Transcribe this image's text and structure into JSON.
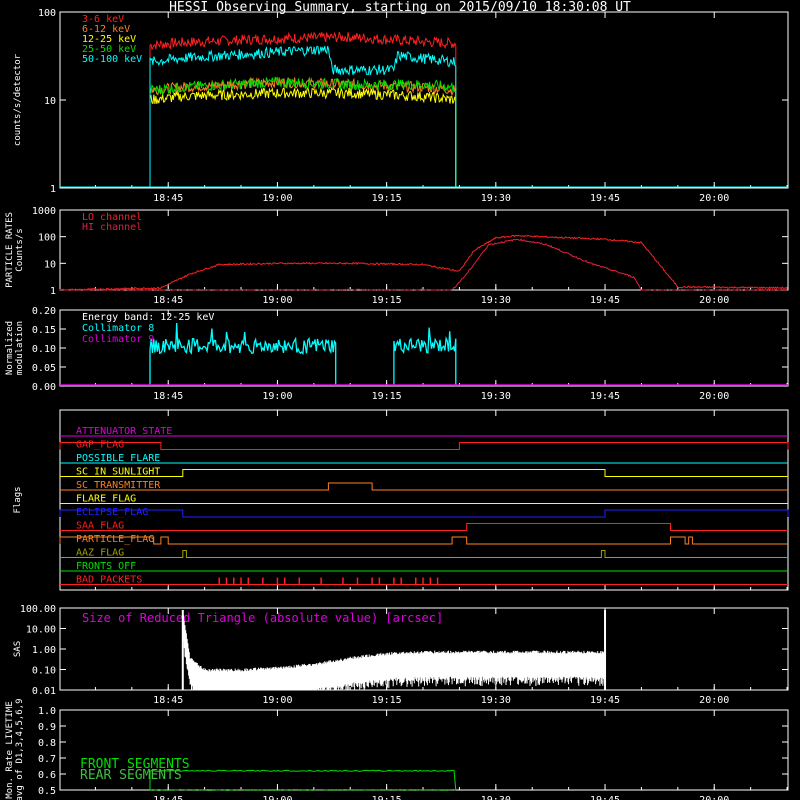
{
  "title": "HESSI Observing Summary, starting on 2015/09/10 18:30:08 UT",
  "time_ticks": [
    "18:45",
    "19:00",
    "19:15",
    "19:30",
    "19:45",
    "20:00"
  ],
  "colors": {
    "bg": "#000000",
    "axis": "#ffffff",
    "red": "#ff2020",
    "orange": "#ff7f1e",
    "yellow": "#ffff00",
    "green": "#00e000",
    "cyan": "#00ffff",
    "magenta": "#e000e0",
    "blue": "#2020ff",
    "olive": "#a0a000",
    "crimson": "#e02040",
    "flare_green": "#40c040"
  },
  "chart_data": [
    {
      "type": "line",
      "id": "count-rates",
      "ylabel": "counts/s/detector",
      "ylim": [
        1,
        100
      ],
      "log": true,
      "yticks": [
        "1",
        "10",
        "100"
      ],
      "xlim": [
        "18:30:08",
        "20:10:08"
      ],
      "series": [
        {
          "name": "3-6 keV",
          "color_key": "red",
          "x": [
            "18:42:30",
            "18:47",
            "19:00",
            "19:10",
            "19:20",
            "19:24:30"
          ],
          "values": [
            42,
            45,
            50,
            52,
            46,
            44
          ]
        },
        {
          "name": "6-12 keV",
          "color_key": "orange",
          "x": [
            "18:42:30",
            "18:47",
            "19:00",
            "19:10",
            "19:20",
            "19:24:30"
          ],
          "values": [
            13,
            14,
            16,
            15,
            14,
            13
          ]
        },
        {
          "name": "12-25 keV",
          "color_key": "yellow",
          "x": [
            "18:42:30",
            "18:47",
            "19:00",
            "19:10",
            "19:20",
            "19:24:30"
          ],
          "values": [
            10,
            11,
            12,
            12,
            11,
            10
          ]
        },
        {
          "name": "25-50 keV",
          "color_key": "green",
          "x": [
            "18:42:30",
            "18:47",
            "19:00",
            "19:10",
            "19:20",
            "19:24:30"
          ],
          "values": [
            13,
            14,
            16,
            15,
            15,
            14
          ]
        },
        {
          "name": "50-100 keV",
          "color_key": "cyan",
          "x": [
            "18:42:30",
            "18:47",
            "19:00",
            "19:07",
            "19:07:30",
            "19:16",
            "19:16:30",
            "19:24:30"
          ],
          "values": [
            27,
            30,
            35,
            38,
            22,
            22,
            32,
            27
          ]
        }
      ]
    },
    {
      "type": "line",
      "id": "particle-rates",
      "ylabel_lines": [
        "PARTICLE RATES",
        "Counts/s"
      ],
      "ylim": [
        1,
        1000
      ],
      "log": true,
      "yticks": [
        "1",
        "10",
        "100",
        "1000"
      ],
      "series": [
        {
          "name": "LO channel",
          "color_key": "red",
          "x": [
            "18:30:08",
            "18:44",
            "18:48",
            "18:52",
            "19:00",
            "19:10",
            "19:20",
            "19:25",
            "19:27",
            "19:30",
            "19:33",
            "19:36",
            "19:45",
            "19:50",
            "19:53",
            "19:55",
            "20:10"
          ],
          "values": [
            1,
            1.2,
            4,
            9,
            10,
            10,
            9,
            5,
            30,
            90,
            110,
            100,
            80,
            60,
            6,
            1.3,
            1.2
          ]
        },
        {
          "name": "HI channel",
          "color_key": "crimson",
          "x": [
            "18:30:08",
            "19:24",
            "19:26",
            "19:29",
            "19:33",
            "19:37",
            "19:43",
            "19:49",
            "19:50",
            "20:10"
          ],
          "values": [
            1,
            1,
            4,
            50,
            80,
            50,
            10,
            3,
            1,
            1
          ]
        }
      ]
    },
    {
      "type": "line",
      "id": "modulation",
      "ylabel_lines": [
        "Normalized",
        "modulation"
      ],
      "ylim": [
        0,
        0.2
      ],
      "yticks": [
        "0.00",
        "0.05",
        "0.10",
        "0.15",
        "0.20"
      ],
      "annotation": "Energy band: 12-25 keV",
      "series": [
        {
          "name": "Collimator 8",
          "color_key": "cyan",
          "segments": [
            [
              "18:42:30",
              "19:08"
            ],
            [
              "19:16",
              "19:24:30"
            ]
          ],
          "value": 0.105
        },
        {
          "name": "Collimator 9",
          "color_key": "magenta",
          "value": 0.0
        }
      ]
    },
    {
      "type": "table",
      "id": "flags",
      "ylabel": "Flags",
      "rows": [
        {
          "label": "ATTENUATOR_STATE",
          "color_key": "magenta",
          "on": []
        },
        {
          "label": "GAP_FLAG",
          "color_key": "red",
          "on": [
            [
              "18:30:08",
              "18:44"
            ],
            [
              "19:25",
              "20:10:08"
            ]
          ]
        },
        {
          "label": "POSSIBLE_FLARE",
          "color_key": "cyan",
          "on": []
        },
        {
          "label": "SC_IN_SUNLIGHT",
          "color_key": "yellow",
          "on": [
            [
              "18:47",
              "19:45"
            ]
          ]
        },
        {
          "label": "SC_TRANSMITTER",
          "color_key": "orange",
          "on": [
            [
              "19:07",
              "19:13"
            ]
          ]
        },
        {
          "label": "FLARE_FLAG",
          "color_key": "yellow",
          "on": []
        },
        {
          "label": "ECLIPSE_FLAG",
          "color_key": "blue",
          "on": [
            [
              "18:30:08",
              "18:47"
            ],
            [
              "19:45",
              "20:10:08"
            ]
          ]
        },
        {
          "label": "SAA_FLAG",
          "color_key": "red",
          "on": [
            [
              "19:26",
              "19:54"
            ]
          ]
        },
        {
          "label": "PARTICLE_FLAG",
          "color_key": "orange",
          "on": [
            [
              "18:30:08",
              "18:43"
            ],
            [
              "18:44",
              "18:45"
            ],
            [
              "19:24",
              "19:26"
            ],
            [
              "19:54",
              "19:56"
            ],
            [
              "19:56:30",
              "19:57"
            ]
          ]
        },
        {
          "label": "AAZ_FLAG",
          "color_key": "olive",
          "on": [
            [
              "18:47",
              "18:47:30"
            ],
            [
              "19:44:30",
              "19:45"
            ]
          ]
        },
        {
          "label": "FRONTS_OFF",
          "color_key": "green",
          "on": []
        },
        {
          "label": "BAD_PACKETS",
          "color_key": "red",
          "ticks": [
            "18:52",
            "18:53",
            "18:54",
            "18:55",
            "18:56",
            "18:58",
            "19:00",
            "19:01",
            "19:03",
            "19:06",
            "19:09",
            "19:11",
            "19:13",
            "19:14",
            "19:16",
            "19:17",
            "19:19",
            "19:20",
            "19:21",
            "19:22"
          ]
        }
      ]
    },
    {
      "type": "line",
      "id": "sas",
      "ylabel": "SAS",
      "ylim": [
        0.01,
        100
      ],
      "log": true,
      "yticks": [
        "0.01",
        "0.10",
        "1.00",
        "10.00",
        "100.00"
      ],
      "annotation": "Size of Reduced Triangle (absolute value) [arcsec]",
      "series": [
        {
          "name": "triangle",
          "color_key": "axis",
          "x": [
            "18:47",
            "18:48",
            "18:50",
            "18:55",
            "19:00",
            "19:05",
            "19:10",
            "19:15",
            "19:20",
            "19:30",
            "19:40",
            "19:45"
          ],
          "values": [
            60,
            0.3,
            0.08,
            0.08,
            0.1,
            0.15,
            0.3,
            0.5,
            0.6,
            0.6,
            0.6,
            0.6
          ]
        }
      ]
    },
    {
      "type": "line",
      "id": "livetime",
      "ylabel_lines": [
        "Mon. Rate LIVETIME",
        "avg of D1,3,4,5,6,9"
      ],
      "ylim": [
        0.5,
        1.0
      ],
      "yticks": [
        "0.5",
        "0.6",
        "0.7",
        "0.8",
        "0.9",
        "1.0"
      ],
      "series": [
        {
          "name": "FRONT SEGMENTS",
          "color_key": "green",
          "x": [
            "18:42:30",
            "19:24:30"
          ],
          "values": [
            0.62,
            0.62
          ]
        },
        {
          "name": "REAR SEGMENTS",
          "color_key": "flare_green",
          "x": [
            "18:42:30",
            "19:24:30"
          ],
          "values": [
            0.5,
            0.5
          ]
        }
      ]
    }
  ]
}
